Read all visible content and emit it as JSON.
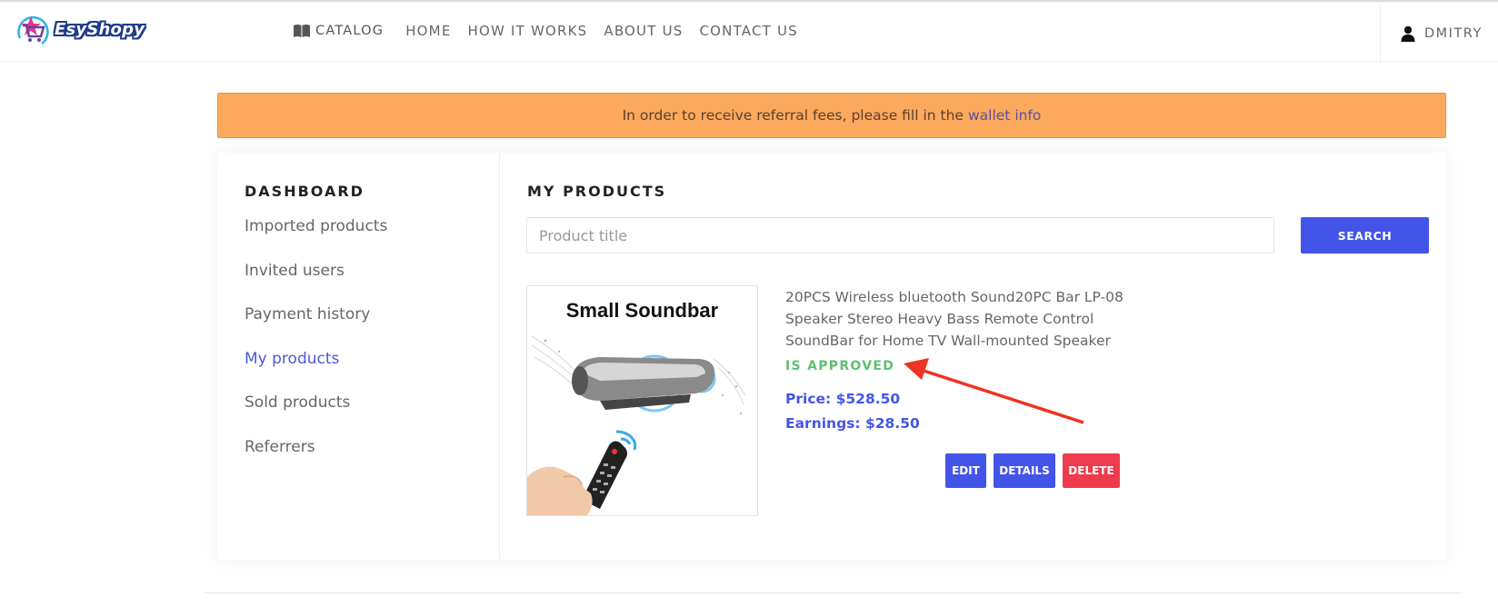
{
  "header": {
    "logo_text": "EsyShopy",
    "nav": [
      {
        "label": "CATALOG",
        "icon": "book-icon"
      },
      {
        "label": "HOME"
      },
      {
        "label": "HOW IT WORKS"
      },
      {
        "label": "ABOUT US"
      },
      {
        "label": "CONTACT US"
      }
    ],
    "user": {
      "name": "DMITRY",
      "icon": "user-icon"
    }
  },
  "alert": {
    "text": "In order to receive referral fees, please fill in the",
    "link_label": "wallet info"
  },
  "sidebar": {
    "title": "DASHBOARD",
    "items": [
      {
        "label": "Imported products",
        "active": false
      },
      {
        "label": "Invited users",
        "active": false
      },
      {
        "label": "Payment history",
        "active": false
      },
      {
        "label": "My products",
        "active": true
      },
      {
        "label": "Sold products",
        "active": false
      },
      {
        "label": "Referrers",
        "active": false
      }
    ]
  },
  "main": {
    "title": "MY PRODUCTS",
    "search": {
      "placeholder": "Product title",
      "value": "",
      "button_label": "SEARCH"
    },
    "product": {
      "image_caption": "Small  Soundbar",
      "name": "20PCS Wireless bluetooth Sound20PC Bar LP-08 Speaker Stereo Heavy Bass Remote Control SoundBar for Home TV Wall-mounted Speaker",
      "status": "IS APPROVED",
      "price": "Price: $528.50",
      "earnings": "Earnings: $28.50",
      "actions": {
        "edit": "EDIT",
        "details": "DETAILS",
        "delete": "DELETE"
      }
    }
  },
  "colors": {
    "accent": "#4355e8",
    "alert_bg": "#fca95d",
    "approved": "#5fbf6e",
    "danger": "#ef3b4e",
    "annotation_arrow": "#ee3322"
  }
}
